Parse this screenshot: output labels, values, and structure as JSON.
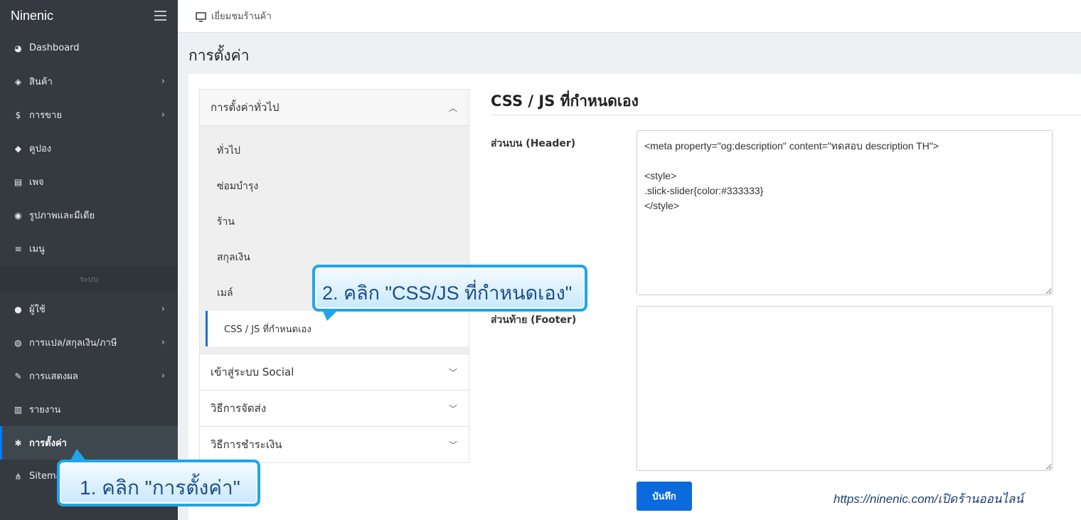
{
  "sidebar": {
    "brand": "Ninenic",
    "items": [
      {
        "label": "Dashboard",
        "icon": "dashboard-icon",
        "glyph": "◕",
        "chevron": false
      },
      {
        "label": "สินค้า",
        "icon": "box-icon",
        "glyph": "◈",
        "chevron": true
      },
      {
        "label": "การขาย",
        "icon": "dollar-icon",
        "glyph": "$",
        "chevron": true
      },
      {
        "label": "คูปอง",
        "icon": "tag-icon",
        "glyph": "◆",
        "chevron": false
      },
      {
        "label": "เพจ",
        "icon": "file-icon",
        "glyph": "▤",
        "chevron": false
      },
      {
        "label": "รูปภาพและมีเดีย",
        "icon": "camera-icon",
        "glyph": "◉",
        "chevron": false
      },
      {
        "label": "เมนู",
        "icon": "list-icon",
        "glyph": "≡",
        "chevron": false
      }
    ],
    "section_label": "ระบบ",
    "items2": [
      {
        "label": "ผู้ใช้",
        "icon": "users-icon",
        "glyph": "●",
        "chevron": true
      },
      {
        "label": "การแปล/สกุลเงิน/ภาษี",
        "icon": "globe-icon",
        "glyph": "◍",
        "chevron": true
      },
      {
        "label": "การแสดงผล",
        "icon": "brush-icon",
        "glyph": "✎",
        "chevron": true
      },
      {
        "label": "รายงาน",
        "icon": "chart-icon",
        "glyph": "▥",
        "chevron": false
      },
      {
        "label": "การตั้งค่า",
        "icon": "gears-icon",
        "glyph": "✱",
        "chevron": false,
        "active": true
      },
      {
        "label": "Sitemap",
        "icon": "sitemap-icon",
        "glyph": "⋔",
        "chevron": false
      }
    ]
  },
  "topbar": {
    "label": "เยี่ยมชมร้านค้า",
    "icon": "monitor-icon"
  },
  "page_title": "การตั้งค่า",
  "accordion": {
    "general_header": "การตั้งค่าทั่วไป",
    "sub_items": [
      "ทั่วไป",
      "ซ่อมบำรุง",
      "ร้าน",
      "สกุลเงิน",
      "เมล์",
      "CSS / JS ที่กำหนดเอง"
    ],
    "active_index": 5,
    "other_sections": [
      "เข้าสู่ระบบ Social",
      "วิธีการจัดส่ง",
      "วิธีการชำระเงิน"
    ]
  },
  "content": {
    "title": "CSS / JS ที่กำหนดเอง",
    "header_label": "ส่วนบน (Header)",
    "header_value": "<meta property=\"og:description\" content=\"ทดสอบ description TH\">\n\n<style>\n.slick-slider{color:#333333}\n</style>",
    "footer_label": "ส่วนท้าย (Footer)",
    "footer_value": "",
    "save_label": "บันทึก"
  },
  "annotations": {
    "step1": "1. คลิก \"การตั้งค่า\"",
    "step2": "2. คลิก \"CSS/JS ที่กำหนดเอง\"",
    "watermark": "https://ninenic.com/เปิดร้านออนไลน์"
  },
  "colors": {
    "sidebar_bg": "#343a40",
    "accent": "#007bff",
    "save_button": "#0b6bdc",
    "callout_border": "#1ea6ea"
  }
}
